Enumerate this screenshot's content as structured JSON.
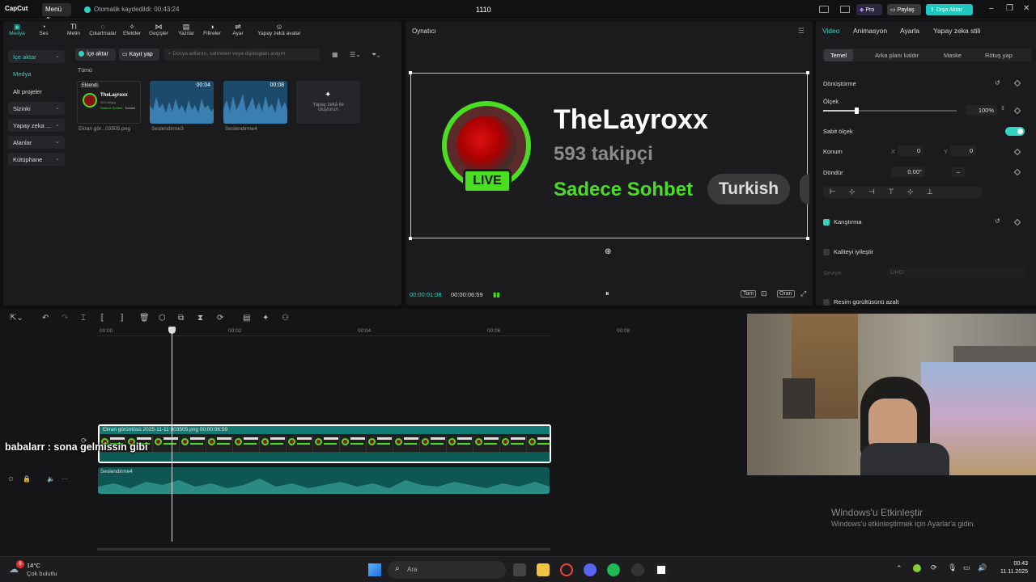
{
  "topbar": {
    "logo": "CapCut",
    "menu": "Menü",
    "autosave": "Otomatik kaydedildi: 00:43:24",
    "title": "1110",
    "pro": "Pro",
    "share": "Paylaş",
    "export": "Dışa Aktar"
  },
  "tools": [
    {
      "label": "Medya",
      "icon": "media-icon",
      "glyph": "▣"
    },
    {
      "label": "Ses",
      "icon": "audio-icon",
      "glyph": "◔"
    },
    {
      "label": "Metin",
      "icon": "text-icon",
      "glyph": "TI"
    },
    {
      "label": "Çıkartmalar",
      "icon": "sticker-icon",
      "glyph": "◌"
    },
    {
      "label": "Efektler",
      "icon": "effects-icon",
      "glyph": "✧"
    },
    {
      "label": "Geçişler",
      "icon": "transitions-icon",
      "glyph": "⋈"
    },
    {
      "label": "Yazılar",
      "icon": "captions-icon",
      "glyph": "▤"
    },
    {
      "label": "Filtreler",
      "icon": "filters-icon",
      "glyph": "◑"
    },
    {
      "label": "Ayar",
      "icon": "adjust-icon",
      "glyph": "⇌"
    },
    {
      "label": "Yapay zekâ avatar",
      "icon": "ai-avatar-icon",
      "glyph": "☺"
    }
  ],
  "sidebar": [
    {
      "label": "İçe aktar"
    },
    {
      "label": "Medya"
    },
    {
      "label": "Alt projeler"
    },
    {
      "label": "Sizinki"
    },
    {
      "label": "Yapay zeka ..."
    },
    {
      "label": "Alanlar"
    },
    {
      "label": "Kütüphane"
    }
  ],
  "media": {
    "import": "İçe aktar",
    "record": "Kayıt yap",
    "search_placeholder": "Dosya adlarını, sahneleri veya diyalogları arayın",
    "all": "Tümü",
    "items": [
      {
        "caption": "Ekran gör...03505.png",
        "badge": "Eklendi"
      },
      {
        "caption": "Seslendirme3",
        "duration": "00:04"
      },
      {
        "caption": "Seslendirme4",
        "duration": "00:08"
      },
      {
        "caption": "Yapay zekâ ile oluşturun"
      }
    ],
    "thumb_text": {
      "name": "TheLayroxx",
      "followers": "593 takipçi",
      "chat": "Sadece Sohbet",
      "tag": "Turkish"
    }
  },
  "player": {
    "title": "Oynatıcı",
    "current": "00:00:01:08",
    "total": "00:00:06:59",
    "full_btn": "Tam",
    "ratio_btn": "Oran"
  },
  "preview": {
    "name": "TheLayroxx",
    "followers": "593 takipçi",
    "chat": "Sadece Sohbet",
    "tag": "Turkish",
    "live": "LIVE"
  },
  "rpanel": {
    "tabs": [
      "Video",
      "Animasyon",
      "Ayarla",
      "Yapay zeka stili"
    ],
    "subtabs": [
      "Temel",
      "Arka planı kaldır",
      "Maske",
      "Rötuş yap"
    ],
    "transform": "Dönüştürme",
    "scale": "Ölçek",
    "scale_value": "100%",
    "scale_level": 0.25,
    "uniform": "Sabit ölçek",
    "position": "Konum",
    "x_label": "X",
    "x_value": "0",
    "y_label": "Y",
    "y_value": "0",
    "rotate": "Döndür",
    "rotate_value": "0.00°",
    "rotate_extra": "–",
    "blend": "Karıştırma",
    "enhance": "Kaliteyi iyileştir",
    "level": "Seviye",
    "level_value": "UHD",
    "denoise": "Resim gürültüsünü azalt"
  },
  "timeline": {
    "ruler": [
      "00:00",
      "00:02",
      "00:04",
      "00:06",
      "00:08"
    ],
    "video_clip": "Ekran görüntüsü 2025-11-11 003505.png  00:00:06:59",
    "frame_text": {
      "name": "TheLayroxx",
      "sub": "593 takipçi"
    },
    "audio_clip": "Seslendirme4"
  },
  "overlay": {
    "chat": "babalarr : sona gelmissin gibi"
  },
  "watermark": {
    "line1": "Windows'u Etkinleştir",
    "line2": "Windows'u etkinleştirmek için Ayarlar'a gidin."
  },
  "taskbar": {
    "temp": "14°C",
    "desc": "Çok bulutlu",
    "badge": "6",
    "search": "Ara",
    "time": "00:43",
    "date": "11.11.2025"
  },
  "colors": {
    "accent": "#2fd3c0",
    "live_green": "#4ade23"
  }
}
